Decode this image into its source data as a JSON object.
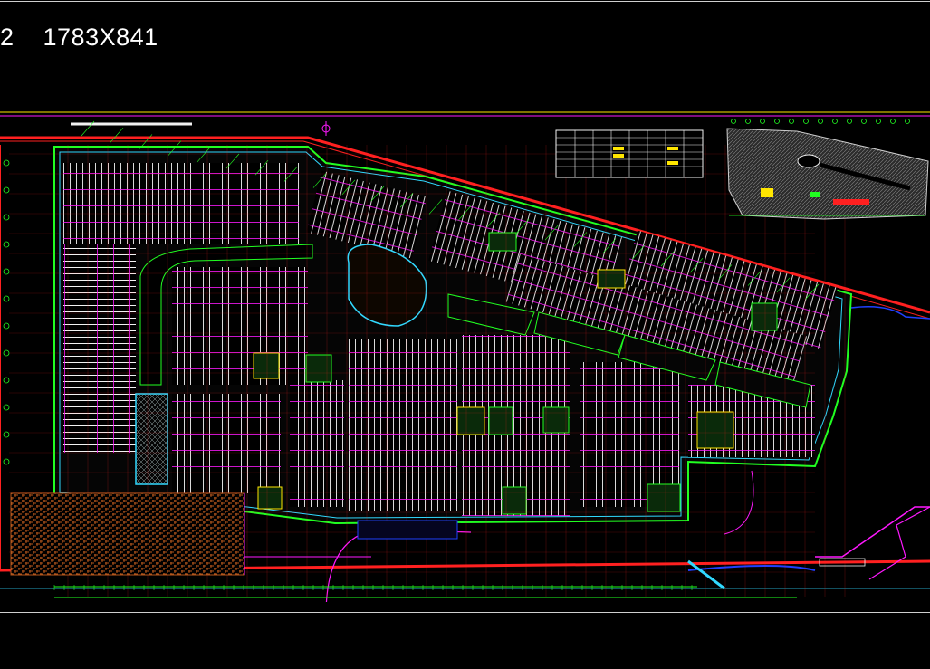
{
  "viewer": {
    "sheet_label": "2    1783X841"
  },
  "colors": {
    "background": "#000000",
    "boundary_red": "#ff2020",
    "parking_white": "#f2f2f2",
    "wall_magenta": "#ff19ff",
    "grid_green": "#21ff21",
    "frame_gray": "#cfcfcf",
    "road_blue": "#2040ff",
    "paving_brown": "#b3561c",
    "ramp_cyan": "#31d9ff"
  },
  "icons": {
    "north_arrow": "north-arrow-icon"
  },
  "legend_table": {
    "rows": 6,
    "columns": 8,
    "highlighted_column": "yellow"
  },
  "key_plan": {
    "shape": "site-outline-hatched"
  }
}
